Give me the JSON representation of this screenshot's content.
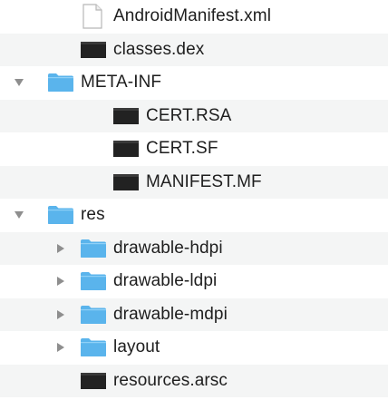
{
  "file_tree": {
    "items": [
      {
        "label": "AndroidManifest.xml",
        "depth": 1,
        "icon": "document-icon",
        "expandable": false
      },
      {
        "label": "classes.dex",
        "depth": 1,
        "icon": "binary-file-icon",
        "expandable": false
      },
      {
        "label": "META-INF",
        "depth": 0,
        "icon": "folder-icon",
        "expandable": true,
        "expanded": true
      },
      {
        "label": "CERT.RSA",
        "depth": 2,
        "icon": "binary-file-icon",
        "expandable": false
      },
      {
        "label": "CERT.SF",
        "depth": 2,
        "icon": "binary-file-icon",
        "expandable": false
      },
      {
        "label": "MANIFEST.MF",
        "depth": 2,
        "icon": "binary-file-icon",
        "expandable": false
      },
      {
        "label": "res",
        "depth": 0,
        "icon": "folder-icon",
        "expandable": true,
        "expanded": true
      },
      {
        "label": "drawable-hdpi",
        "depth": 1,
        "icon": "folder-icon",
        "expandable": true,
        "expanded": false
      },
      {
        "label": "drawable-ldpi",
        "depth": 1,
        "icon": "folder-icon",
        "expandable": true,
        "expanded": false
      },
      {
        "label": "drawable-mdpi",
        "depth": 1,
        "icon": "folder-icon",
        "expandable": true,
        "expanded": false
      },
      {
        "label": "layout",
        "depth": 1,
        "icon": "folder-icon",
        "expandable": true,
        "expanded": false
      },
      {
        "label": "resources.arsc",
        "depth": 1,
        "icon": "binary-file-icon",
        "expandable": false
      }
    ]
  },
  "colors": {
    "folder": "#5ab4ec",
    "binary_file": "#222222",
    "disclosure": "#8e8e8e",
    "row_alt": "#f4f5f5"
  }
}
